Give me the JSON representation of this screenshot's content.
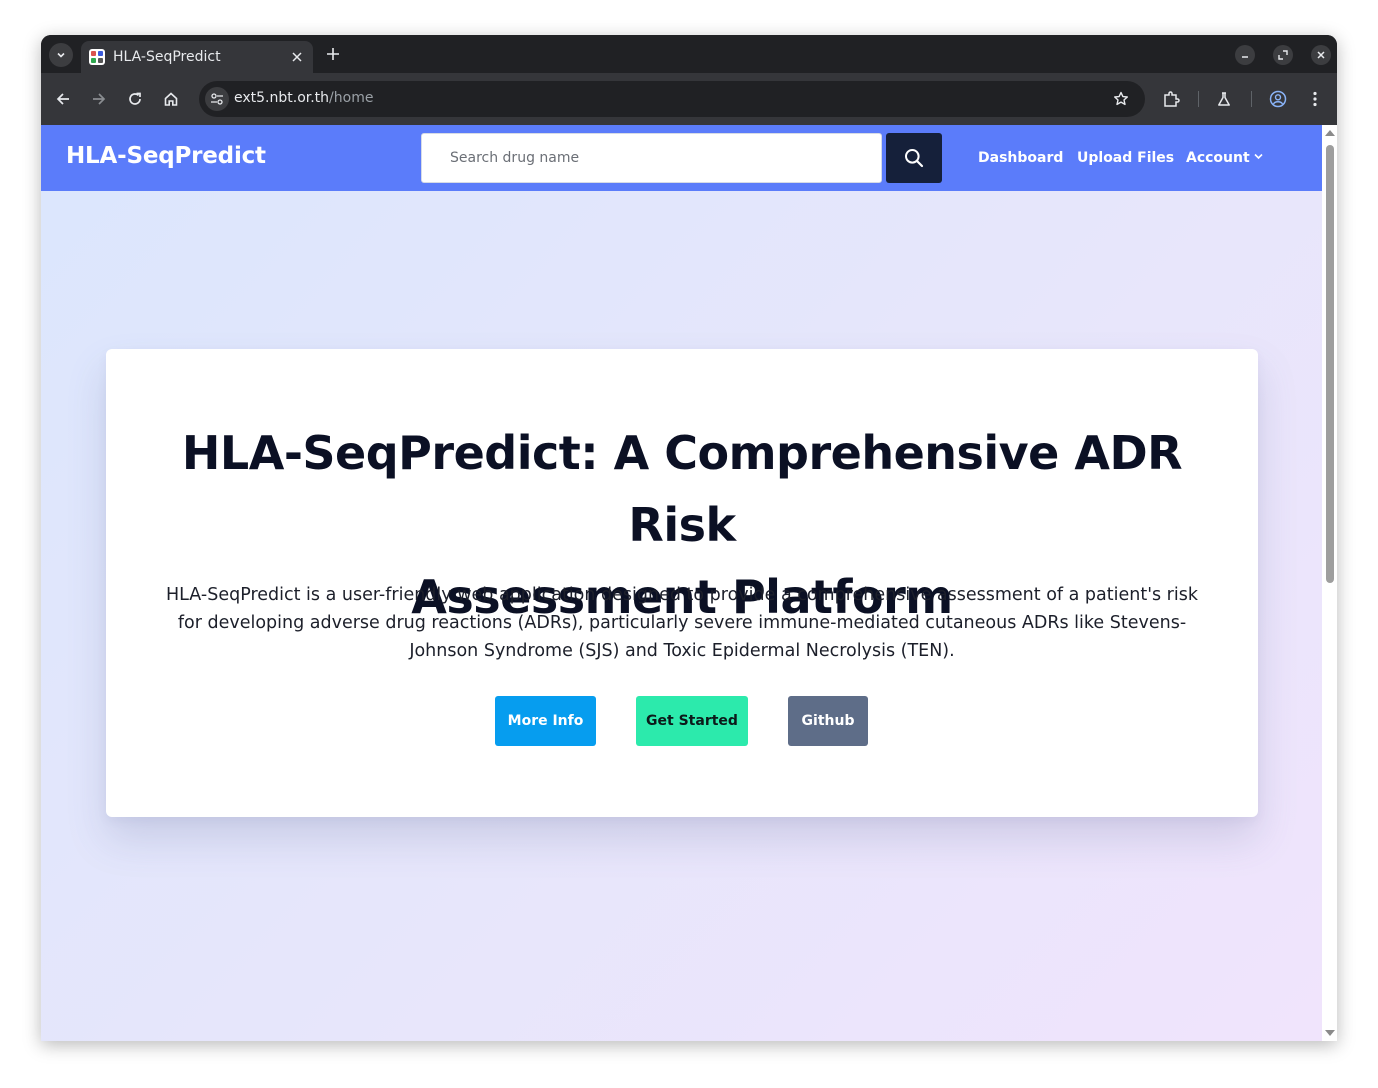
{
  "browser": {
    "tab_title": "HLA-SeqPredict",
    "url_host": "ext5.nbt.or.th",
    "url_path": "/home"
  },
  "app": {
    "brand": "HLA-SeqPredict",
    "search_placeholder": "Search drug name",
    "nav": {
      "dashboard": "Dashboard",
      "upload": "Upload Files",
      "account": "Account"
    }
  },
  "hero": {
    "title_line1": "HLA-SeqPredict: A Comprehensive ADR Risk",
    "title_line2": "Assessment Platform",
    "description": "HLA-SeqPredict is a user-friendly web application designed to provide a comprehensive assessment of a patient's risk for developing adverse drug reactions (ADRs), particularly severe immune-mediated cutaneous ADRs like Stevens-Johnson Syndrome (SJS) and Toxic Epidermal Necrolysis (TEN).",
    "buttons": {
      "more_info": "More Info",
      "get_started": "Get Started",
      "github": "Github"
    }
  },
  "colors": {
    "navbar": "#5b7cfa",
    "search_button": "#15203a",
    "more_info": "#069def",
    "get_started": "#2ceaac",
    "github": "#5e6d88"
  }
}
